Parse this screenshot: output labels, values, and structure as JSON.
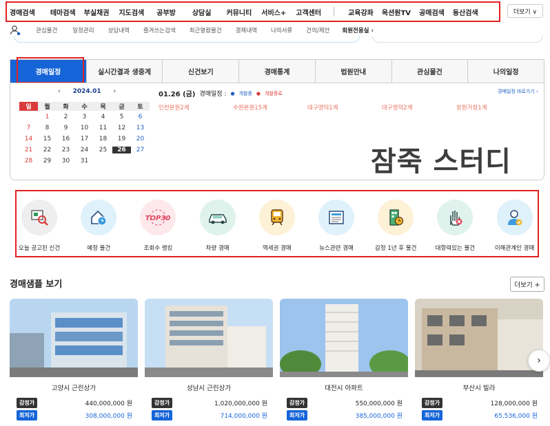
{
  "top_nav": {
    "items": [
      "경매검색",
      "테마검색",
      "부실채권",
      "지도검색",
      "공부방",
      "상담실",
      "커뮤니티",
      "서비스+",
      "고객센터",
      "교육강좌",
      "옥션원TV",
      "공매검색",
      "동산검색"
    ],
    "more": "더보기 ∨"
  },
  "sub_nav": {
    "items": [
      "관심물건",
      "일정관리",
      "상담내역",
      "즐겨쓰는검색",
      "최근열람물건",
      "결제내역",
      "나의서류",
      "건의/제안"
    ],
    "member": "회원전용실 ›"
  },
  "tabs": [
    "경매일정",
    "실시간결과 생중계",
    "신건보기",
    "경매통계",
    "법원안내",
    "관심물건",
    "나의일정"
  ],
  "calendar": {
    "prev": "‹",
    "month": "2024.01",
    "next": "›",
    "weekdays": [
      "일",
      "월",
      "화",
      "수",
      "목",
      "금",
      "토"
    ],
    "weeks": [
      [
        "",
        "1",
        "2",
        "3",
        "4",
        "5",
        "6"
      ],
      [
        "7",
        "8",
        "9",
        "10",
        "11",
        "12",
        "13"
      ],
      [
        "14",
        "15",
        "16",
        "17",
        "18",
        "19",
        "20"
      ],
      [
        "21",
        "22",
        "23",
        "24",
        "25",
        "26",
        "27"
      ],
      [
        "28",
        "29",
        "30",
        "31",
        "",
        "",
        ""
      ]
    ],
    "selected": "26"
  },
  "schedule": {
    "date": "01.26 (금)",
    "label": "경매일정 :",
    "legend_open": "개찰중",
    "legend_done": "개찰종료",
    "link": "경매일정 바로가기 ›",
    "items": [
      "인천본원2계",
      "수원본원15계",
      "대구영덕1계",
      "대구영덕2계",
      "창원거창1계"
    ]
  },
  "watermark": "잠죽 스터디",
  "quick_menu": [
    {
      "label": "오늘 공고된 신건",
      "icon": "document-search-icon",
      "bg": "#eeeeee"
    },
    {
      "label": "예정 물건",
      "icon": "house-clock-icon",
      "bg": "#dff1fa"
    },
    {
      "label": "조회수 랭킹",
      "icon": "top30-icon",
      "bg": "#fde8ec"
    },
    {
      "label": "차량 경매",
      "icon": "car-icon",
      "bg": "#dff3ec"
    },
    {
      "label": "역세권 경매",
      "icon": "train-icon",
      "bg": "#fdf1d6"
    },
    {
      "label": "뉴스관련 경매",
      "icon": "news-icon",
      "bg": "#dff1fa"
    },
    {
      "label": "감정 1년 후 물건",
      "icon": "building-clock-icon",
      "bg": "#fdf1d6"
    },
    {
      "label": "대항력있는 물건",
      "icon": "hand-stop-icon",
      "bg": "#dff3ec"
    },
    {
      "label": "이해관계인 경매",
      "icon": "person-check-icon",
      "bg": "#dff1fa"
    }
  ],
  "samples": {
    "title": "경매샘플 보기",
    "more": "더보기 +",
    "appraisal_label": "감정가",
    "minimum_label": "최저가",
    "cards": [
      {
        "name": "고양시 근린상가",
        "appraisal": "440,000,000 원",
        "minimum": "308,000,000 원"
      },
      {
        "name": "성남시 근린상가",
        "appraisal": "1,020,000,000 원",
        "minimum": "714,000,000 원"
      },
      {
        "name": "대전시 아파트",
        "appraisal": "550,000,000 원",
        "minimum": "385,000,000 원"
      },
      {
        "name": "부산시 빌라",
        "appraisal": "128,000,000 원",
        "minimum": "65,536,000 원"
      }
    ]
  },
  "colors": {
    "accent": "#1565d8",
    "highlight": "#e02020",
    "sunday": "#d93a3a",
    "saturday": "#1e5fc2"
  }
}
